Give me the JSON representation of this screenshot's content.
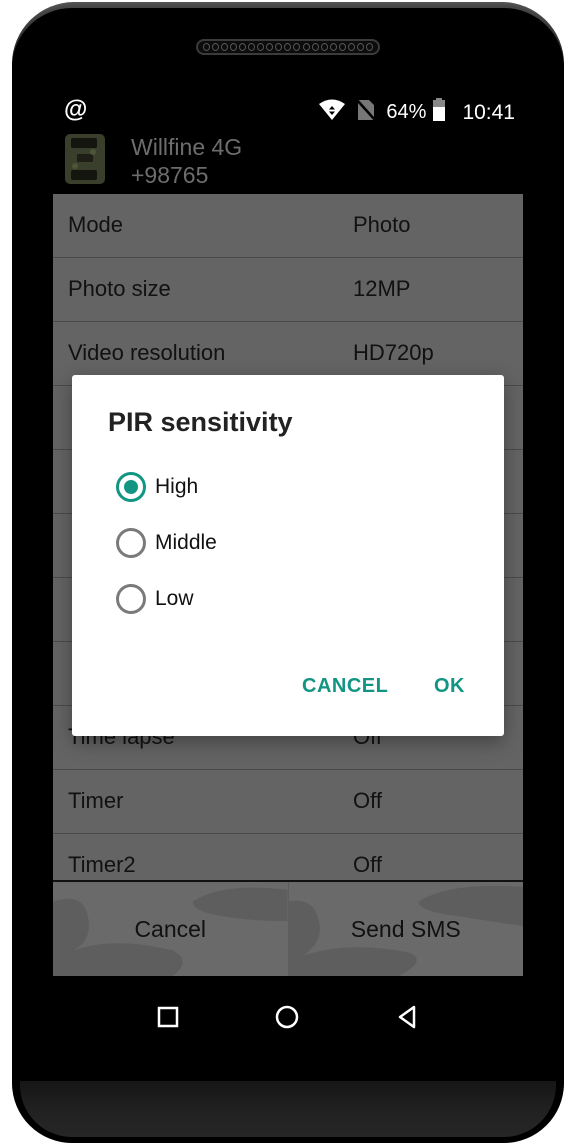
{
  "status_bar": {
    "left_icon": "at-sign-icon",
    "icons": [
      "wifi-data-icon",
      "no-sim-icon",
      "battery-icon"
    ],
    "battery_percent": "64%",
    "time": "10:41"
  },
  "app_header": {
    "device_name": "Willfine 4G",
    "device_number": "+98765",
    "icon": "trail-camera-icon"
  },
  "settings": [
    {
      "label": "Mode",
      "value": "Photo"
    },
    {
      "label": "Photo size",
      "value": "12MP"
    },
    {
      "label": "Video resolution",
      "value": "HD720p"
    },
    {
      "label": "",
      "value": ""
    },
    {
      "label": "",
      "value": ""
    },
    {
      "label": "",
      "value": ""
    },
    {
      "label": "",
      "value": ""
    },
    {
      "label": "",
      "value": ""
    },
    {
      "label": "Time lapse",
      "value": "Off"
    },
    {
      "label": "Timer",
      "value": "Off"
    },
    {
      "label": "Timer2",
      "value": "Off"
    }
  ],
  "bottom_buttons": {
    "cancel": "Cancel",
    "send": "Send SMS"
  },
  "dialog": {
    "title": "PIR sensitivity",
    "options": [
      {
        "label": "High",
        "selected": true
      },
      {
        "label": "Middle",
        "selected": false
      },
      {
        "label": "Low",
        "selected": false
      }
    ],
    "cancel_label": "CANCEL",
    "ok_label": "OK",
    "accent_color": "#129683"
  },
  "nav_bar": {
    "icons": [
      "recents-square-icon",
      "home-circle-icon",
      "back-triangle-icon"
    ]
  }
}
